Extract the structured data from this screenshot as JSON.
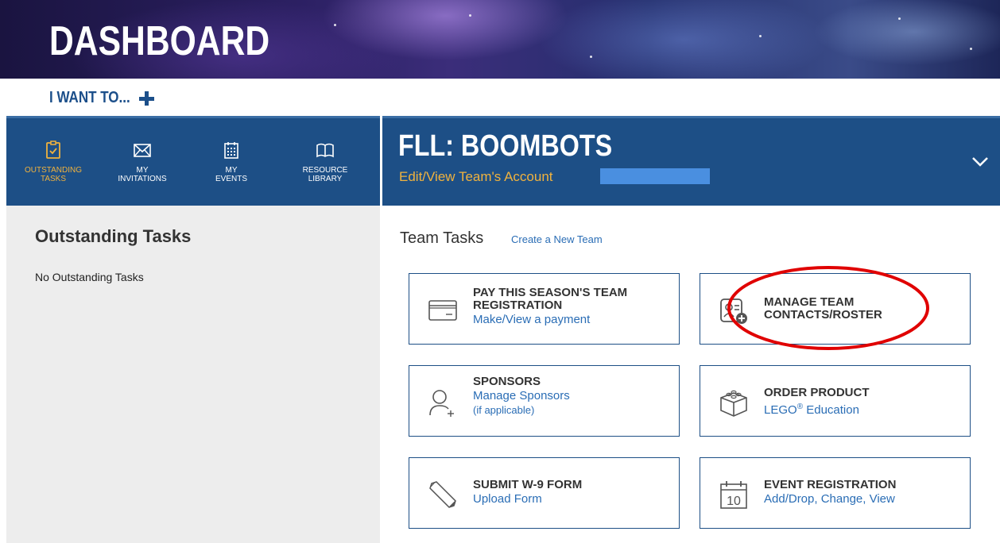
{
  "banner": {
    "title": "DASHBOARD"
  },
  "i_want_to": {
    "label": "I WANT TO..."
  },
  "nav": {
    "items": [
      {
        "label": "OUTSTANDING\nTASKS",
        "icon": "checklist-icon",
        "active": true
      },
      {
        "label": "MY\nINVITATIONS",
        "icon": "envelope-icon",
        "active": false
      },
      {
        "label": "MY\nEVENTS",
        "icon": "calendar-icon",
        "active": false
      },
      {
        "label": "RESOURCE\nLIBRARY",
        "icon": "book-icon",
        "active": false
      }
    ]
  },
  "team": {
    "name": "FLL: BOOMBOTS",
    "account_link": "Edit/View Team's Account"
  },
  "outstanding": {
    "title": "Outstanding Tasks",
    "empty_text": "No Outstanding Tasks"
  },
  "team_tasks": {
    "title": "Team Tasks",
    "create_link": "Create a New Team",
    "cards": [
      {
        "title": "PAY THIS SEASON'S TEAM REGISTRATION",
        "sub": "Make/View a payment",
        "icon": "payment-card-icon"
      },
      {
        "title": "MANAGE TEAM CONTACTS/ROSTER",
        "sub": "",
        "icon": "roster-contacts-icon"
      },
      {
        "title": "SPONSORS",
        "sub": "Manage Sponsors",
        "sub2": "(if applicable)",
        "icon": "add-person-icon"
      },
      {
        "title": "ORDER PRODUCT",
        "sub_pre": "LEGO",
        "sub_sup": "®",
        "sub_post": " Education",
        "icon": "lego-brick-icon"
      },
      {
        "title": "SUBMIT W-9 FORM",
        "sub": "Upload Form",
        "icon": "pen-icon"
      },
      {
        "title": "EVENT REGISTRATION",
        "sub": "Add/Drop, Change, View",
        "icon": "calendar-10-icon"
      }
    ]
  },
  "colors": {
    "nav_blue": "#1d4f86",
    "accent_gold": "#f0b23e",
    "link_blue": "#2a6db5",
    "annotation_red": "#e00000"
  }
}
